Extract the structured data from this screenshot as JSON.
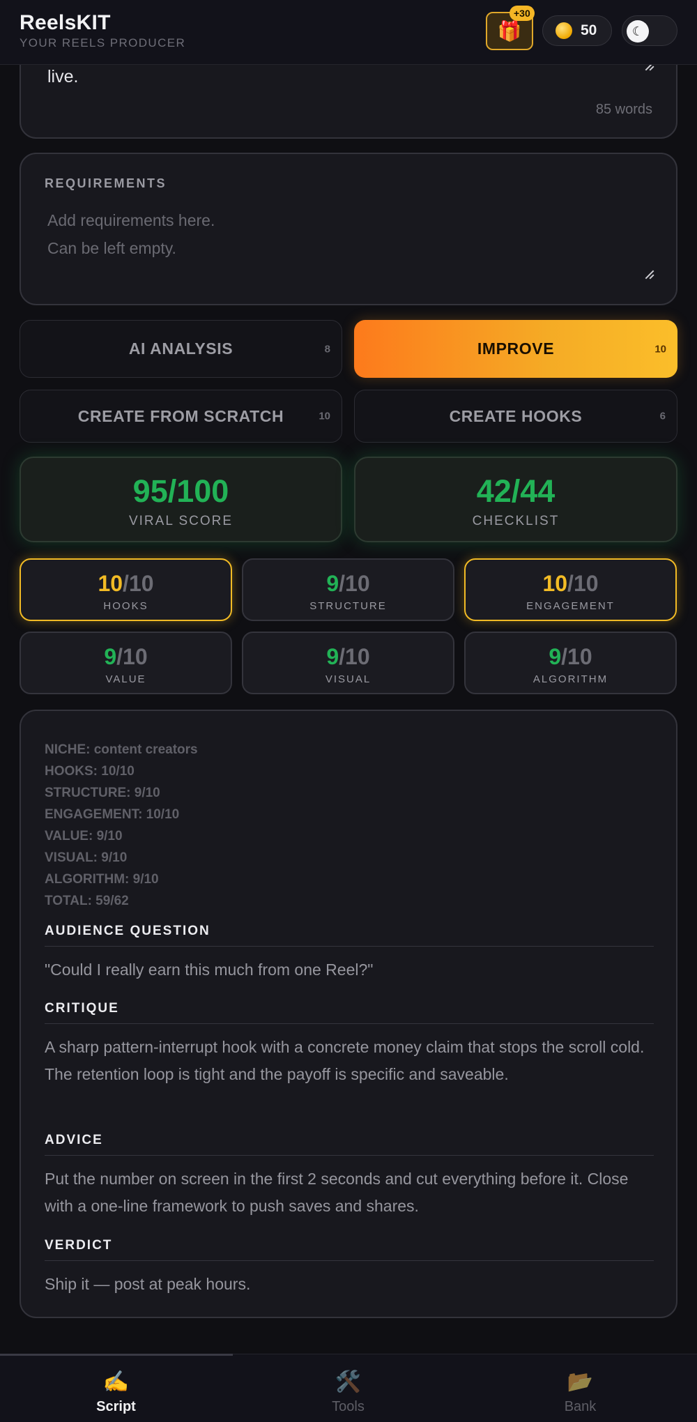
{
  "header": {
    "title": "ReelsKIT",
    "subtitle": "YOUR REELS PRODUCER",
    "gift_badge": "+30",
    "coins": "50"
  },
  "script": {
    "text_tail": "live.",
    "word_count": "85 words"
  },
  "requirements": {
    "label": "REQUIREMENTS",
    "placeholder_line1": "Add requirements here.",
    "placeholder_line2": "Can be left empty."
  },
  "actions": [
    {
      "label": "AI ANALYSIS",
      "cost": "8"
    },
    {
      "label": "IMPROVE",
      "cost": "10"
    },
    {
      "label": "CREATE FROM SCRATCH",
      "cost": "10"
    },
    {
      "label": "CREATE HOOKS",
      "cost": "6"
    }
  ],
  "scores": {
    "viral": {
      "value": "95/100",
      "label": "VIRAL SCORE"
    },
    "checklist": {
      "value": "42/44",
      "label": "CHECKLIST"
    }
  },
  "subscores": [
    {
      "score": "10",
      "max": "/10",
      "label": "HOOKS"
    },
    {
      "score": "9",
      "max": "/10",
      "label": "STRUCTURE"
    },
    {
      "score": "10",
      "max": "/10",
      "label": "ENGAGEMENT"
    },
    {
      "score": "9",
      "max": "/10",
      "label": "VALUE"
    },
    {
      "score": "9",
      "max": "/10",
      "label": "VISUAL"
    },
    {
      "score": "9",
      "max": "/10",
      "label": "ALGORITHM"
    }
  ],
  "analysis": {
    "meta": [
      "NICHE: content creators",
      "HOOKS: 10/10",
      "STRUCTURE: 9/10",
      "ENGAGEMENT: 10/10",
      "VALUE: 9/10",
      "VISUAL: 9/10",
      "ALGORITHM: 9/10",
      "TOTAL: 59/62"
    ],
    "audience_question": {
      "heading": "AUDIENCE QUESTION",
      "body": "\"Could I really earn this much from one Reel?\""
    },
    "critique": {
      "heading": "CRITIQUE",
      "body": "A sharp pattern-interrupt hook with a concrete money claim that stops the scroll cold. The retention loop is tight and the payoff is specific and saveable."
    },
    "advice": {
      "heading": "ADVICE",
      "body": "Put the number on screen in the first 2 seconds and cut everything before it. Close with a one-line framework to push saves and shares."
    },
    "verdict": {
      "heading": "VERDICT",
      "body": "Ship it — post at peak hours."
    }
  },
  "nav": [
    {
      "label": "Script",
      "icon": "writing-hand-icon"
    },
    {
      "label": "Tools",
      "icon": "tools-icon"
    },
    {
      "label": "Bank",
      "icon": "folder-icon"
    }
  ]
}
